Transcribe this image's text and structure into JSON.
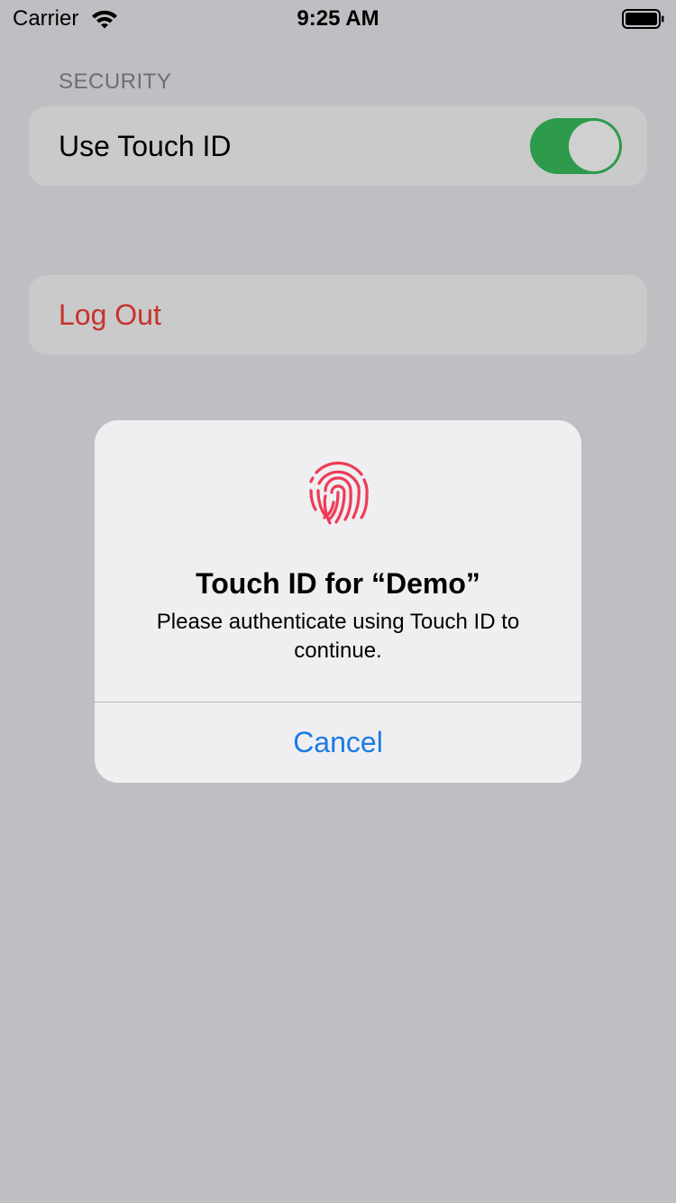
{
  "status_bar": {
    "carrier": "Carrier",
    "time": "9:25 AM",
    "icons": [
      "wifi-icon",
      "battery-icon"
    ]
  },
  "settings": {
    "section_header": "SECURITY",
    "touch_id_label": "Use Touch ID",
    "touch_id_enabled": true,
    "logout_label": "Log Out"
  },
  "alert": {
    "icon": "fingerprint-icon",
    "title": "Touch ID for “Demo”",
    "message": "Please authenticate using Touch ID to continue.",
    "cancel_label": "Cancel"
  },
  "colors": {
    "background": "#bfbfc3",
    "toggle_on": "#2e9a4b",
    "destructive": "#c7322b",
    "link": "#1a7ae6",
    "fingerprint": "#ee3b57"
  }
}
